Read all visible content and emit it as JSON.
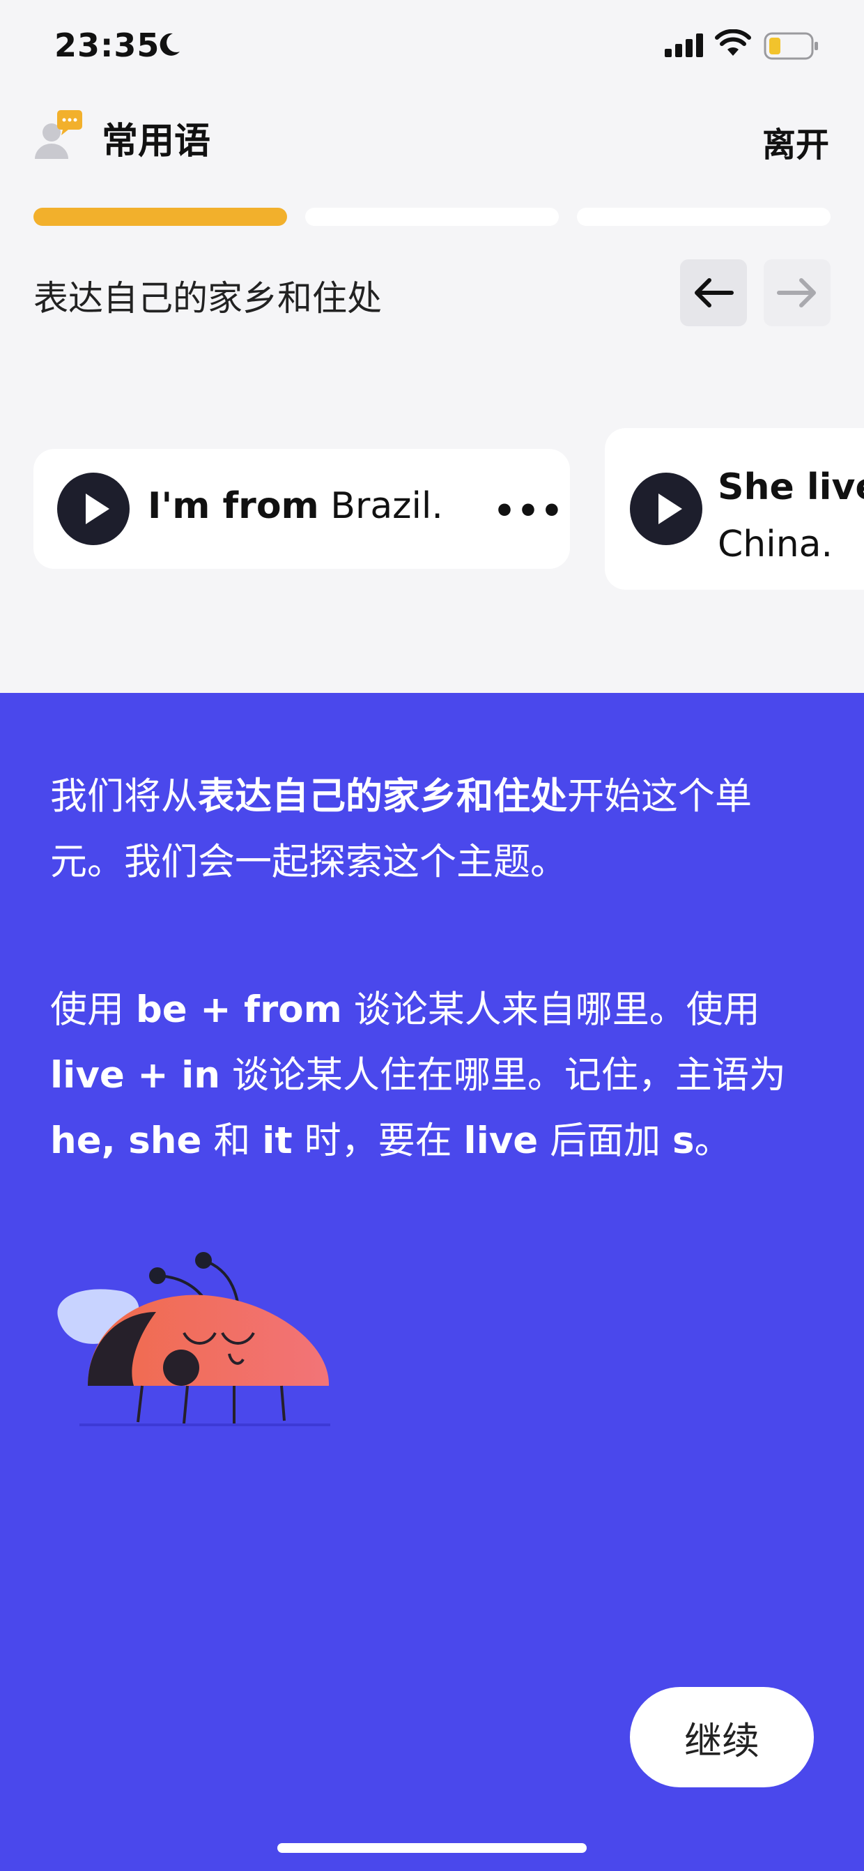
{
  "status_bar": {
    "time": "23:35"
  },
  "header": {
    "title": "常用语",
    "leave_label": "离开"
  },
  "progress": {
    "segments": 3,
    "completed": 1
  },
  "section": {
    "title": "表达自己的家乡和住处"
  },
  "cards": [
    {
      "bold_text": "I'm from",
      "text": "Brazil.",
      "more": "•••"
    },
    {
      "bold_text": "She lives",
      "text": "China."
    }
  ],
  "explanation": {
    "p1_a": "我们将从",
    "p1_bold": "表达自己的家乡和住处",
    "p1_b": "开始这个单元。我们会一起探索这个主题。",
    "p2_a": "使用 ",
    "p2_bold1": "be + from",
    "p2_b": " 谈论某人来自哪里。使用 ",
    "p2_bold2": "live + in",
    "p2_c": " 谈论某人住在哪里。记住，主语为 ",
    "p2_bold3": "he, she",
    "p2_d": " 和 ",
    "p2_bold4": "it",
    "p2_e": " 时，要在 ",
    "p2_bold5": "live",
    "p2_f": " 后面加 ",
    "p2_bold6": "s",
    "p2_g": "。"
  },
  "continue_label": "继续",
  "colors": {
    "accent": "#f2b02c",
    "panel": "#4a48ec",
    "dark": "#1d1e2c"
  },
  "icons": [
    "moon-icon",
    "signal-icon",
    "wifi-icon",
    "battery-icon",
    "chat-user-icon",
    "arrow-left-icon",
    "arrow-right-icon",
    "play-icon",
    "more-icon",
    "ladybug-illustration"
  ]
}
